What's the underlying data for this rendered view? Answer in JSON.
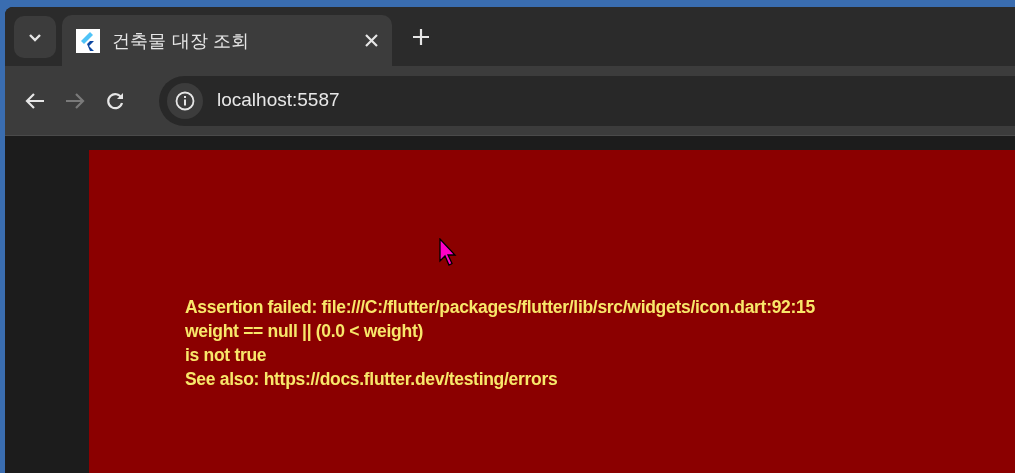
{
  "tabs": [
    {
      "title": "건축물 대장 조회",
      "selected": true
    }
  ],
  "toolbar": {
    "back": {
      "disabled": false
    },
    "forward": {
      "disabled": true
    },
    "address": "localhost:5587"
  },
  "error": {
    "lines": [
      "Assertion failed: file:///C:/flutter/packages/flutter/lib/src/widgets/icon.dart:92:15",
      "weight == null || (0.0 < weight)",
      "is not true",
      "See also: https://docs.flutter.dev/testing/errors"
    ]
  }
}
